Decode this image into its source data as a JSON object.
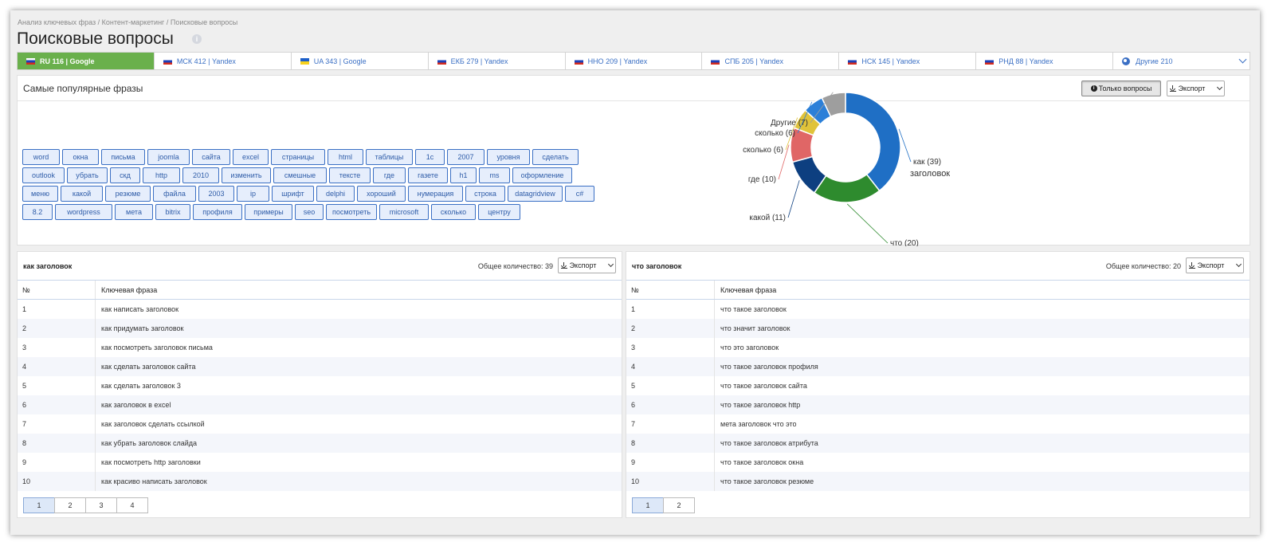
{
  "breadcrumbs": [
    "Анализ ключевых фраз",
    "Контент-маркетинг",
    "Поисковые вопросы"
  ],
  "breadcrumb_sep": " / ",
  "page_title": "Поисковые вопросы",
  "tabs": [
    {
      "label": "RU 116 | Google",
      "flag": "ru",
      "active": true
    },
    {
      "label": "МСК 412 | Yandex",
      "flag": "ru"
    },
    {
      "label": "UA 343 | Google",
      "flag": "ua"
    },
    {
      "label": "ЕКБ 279 | Yandex",
      "flag": "ru"
    },
    {
      "label": "ННО 209 | Yandex",
      "flag": "ru"
    },
    {
      "label": "СПБ 205 | Yandex",
      "flag": "ru"
    },
    {
      "label": "НСК 145 | Yandex",
      "flag": "ru"
    },
    {
      "label": "РНД 88 | Yandex",
      "flag": "ru"
    },
    {
      "label": "Другие 210",
      "flag": "globe-icon"
    }
  ],
  "popular": {
    "title": "Самые популярные фразы",
    "only_questions_label": "Только вопросы",
    "export_label": "Экспорт",
    "tag_rows": [
      [
        "word",
        "окна",
        "письма",
        "joomla",
        "сайта",
        "excel",
        "страницы",
        "html",
        "таблицы",
        "1с",
        "2007",
        "уровня",
        "сделать"
      ],
      [
        "outlook",
        "убрать",
        "скд",
        "http",
        "2010",
        "изменить",
        "смешные",
        "тексте",
        "где",
        "газете",
        "h1",
        "ms",
        "оформление"
      ],
      [
        "меню",
        "какой",
        "резюме",
        "файла",
        "2003",
        "ip",
        "шрифт",
        "delphi",
        "хороший",
        "нумерация",
        "строка",
        "datagridview",
        "c#"
      ],
      [
        "8.2",
        "wordpress",
        "мета",
        "bitrix",
        "профиля",
        "примеры",
        "seo",
        "посмотреть",
        "microsoft",
        "сколько",
        "центру"
      ]
    ]
  },
  "chart_data": {
    "type": "pie",
    "donut": true,
    "center_label": "заголовок",
    "slices": [
      {
        "label": "как (39)",
        "value": 39,
        "color": "#1f6fc5"
      },
      {
        "label": "что (20)",
        "value": 20,
        "color": "#2e8b2e"
      },
      {
        "label": "какой (11)",
        "value": 11,
        "color": "#0d3f80"
      },
      {
        "label": "где (10)",
        "value": 10,
        "color": "#e06666"
      },
      {
        "label": "сколько (6)",
        "value": 6,
        "color": "#e0c33a"
      },
      {
        "label": "сколько (6)",
        "value": 6,
        "color": "#2b7fd8"
      },
      {
        "label": "Другие (7)",
        "value": 7,
        "color": "#9e9e9e"
      }
    ]
  },
  "tables": [
    {
      "title": "как заголовок",
      "count_label": "Общее количество: 39",
      "export_label": "Экспорт",
      "col_num": "№",
      "col_phrase": "Ключевая фраза",
      "rows": [
        [
          "1",
          "как написать заголовок"
        ],
        [
          "2",
          "как придумать заголовок"
        ],
        [
          "3",
          "как посмотреть заголовок письма"
        ],
        [
          "4",
          "как сделать заголовок сайта"
        ],
        [
          "5",
          "как сделать заголовок 3"
        ],
        [
          "6",
          "как заголовок в excel"
        ],
        [
          "7",
          "как заголовок сделать ссылкой"
        ],
        [
          "8",
          "как убрать заголовок слайда"
        ],
        [
          "9",
          "как посмотреть http заголовки"
        ],
        [
          "10",
          "как красиво написать заголовок"
        ]
      ],
      "pages": [
        "1",
        "2",
        "3",
        "4"
      ]
    },
    {
      "title": "что заголовок",
      "count_label": "Общее количество: 20",
      "export_label": "Экспорт",
      "col_num": "№",
      "col_phrase": "Ключевая фраза",
      "rows": [
        [
          "1",
          "что такое заголовок"
        ],
        [
          "2",
          "что значит заголовок"
        ],
        [
          "3",
          "что это заголовок"
        ],
        [
          "4",
          "что такое заголовок профиля"
        ],
        [
          "5",
          "что такое заголовок сайта"
        ],
        [
          "6",
          "что такое заголовок http"
        ],
        [
          "7",
          "мета заголовок что это"
        ],
        [
          "8",
          "что такое заголовок атрибута"
        ],
        [
          "9",
          "что такое заголовок окна"
        ],
        [
          "10",
          "что такое заголовок резюме"
        ]
      ],
      "pages": [
        "1",
        "2"
      ]
    }
  ]
}
